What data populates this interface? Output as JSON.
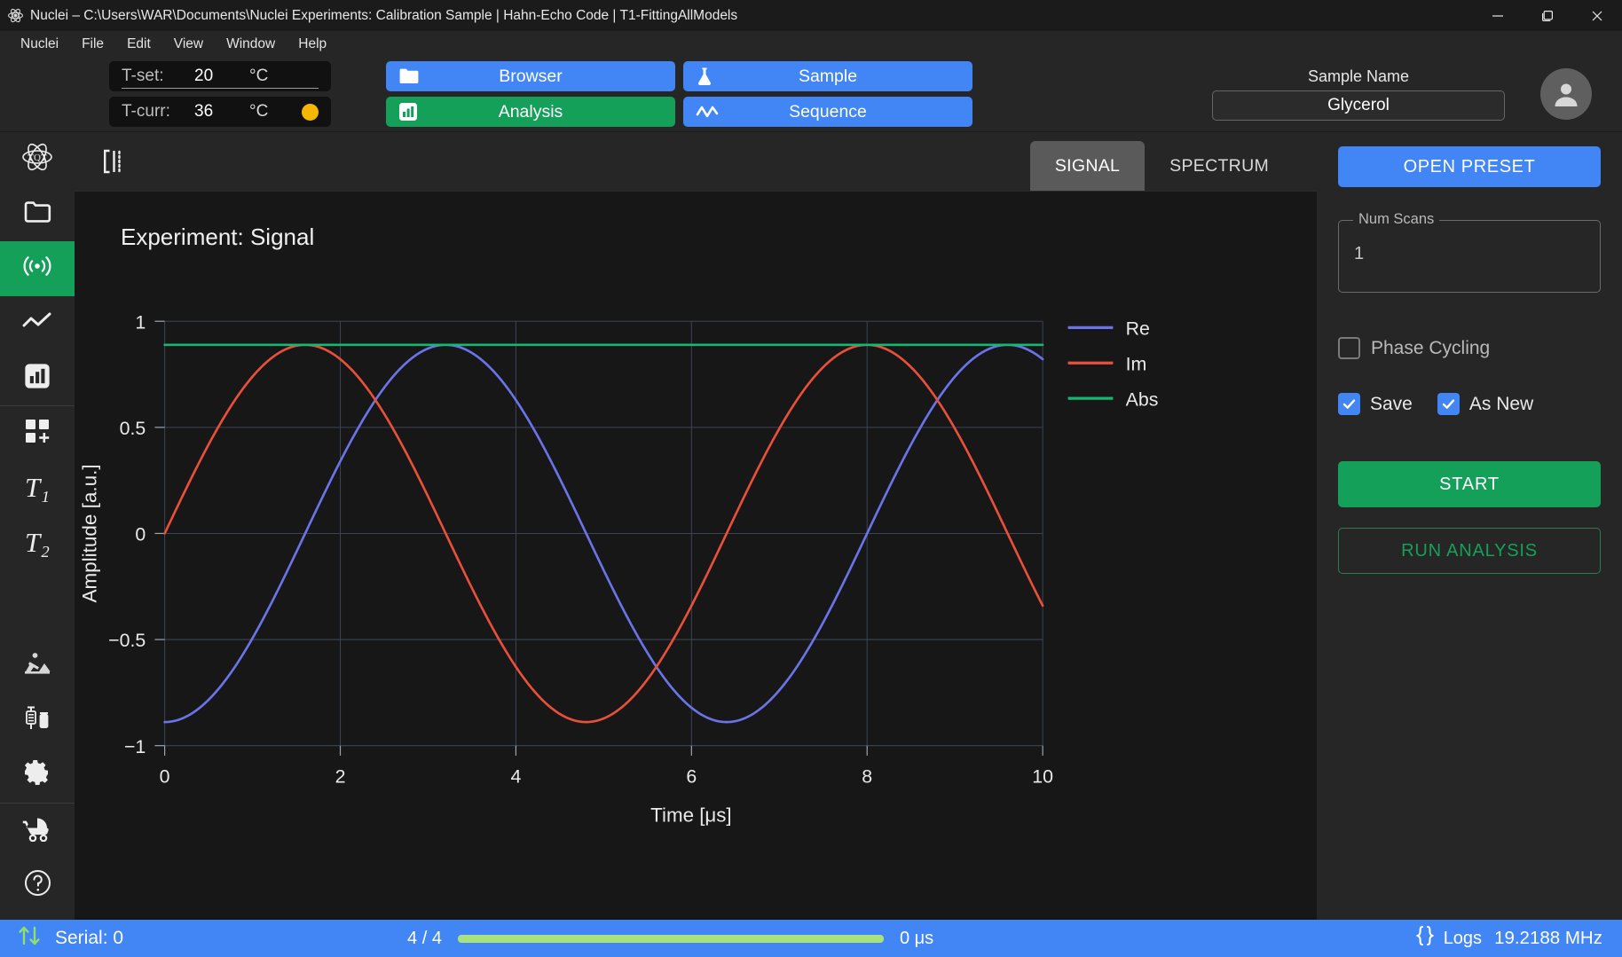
{
  "window": {
    "title": "Nuclei – C:\\Users\\WAR\\Documents\\Nuclei Experiments: Calibration Sample | Hahn-Echo Code | T1-FittingAllModels",
    "app_icon": "atom-icon",
    "minimize": "—",
    "maximize": "❐",
    "close": "✕"
  },
  "menubar": {
    "items": [
      {
        "label": "Nuclei"
      },
      {
        "label": "File"
      },
      {
        "label": "Edit"
      },
      {
        "label": "View"
      },
      {
        "label": "Window"
      },
      {
        "label": "Help"
      }
    ]
  },
  "toolbar": {
    "t_set": {
      "label": "T-set:",
      "value": "20",
      "unit": "°C"
    },
    "t_curr": {
      "label": "T-curr:",
      "value": "36",
      "unit": "°C",
      "status_color": "#f5b800"
    },
    "buttons": [
      {
        "label": "Browser",
        "icon": "folder-icon",
        "color": "#4285f4"
      },
      {
        "label": "Sample",
        "icon": "flask-icon",
        "color": "#4285f4"
      },
      {
        "label": "Analysis",
        "icon": "bar-chart-icon",
        "color": "#15a05a"
      },
      {
        "label": "Sequence",
        "icon": "waveform-icon",
        "color": "#4285f4"
      }
    ],
    "sample": {
      "label": "Sample Name",
      "value": "Glycerol"
    },
    "avatar": "user-avatar-icon"
  },
  "sidebar": {
    "items": [
      {
        "name": "logo",
        "icon": "atom-logo-icon",
        "active": false
      },
      {
        "name": "browser",
        "icon": "folder-icon",
        "active": false
      },
      {
        "name": "signal",
        "icon": "broadcast-icon",
        "active": true
      },
      {
        "name": "trend",
        "icon": "line-chart-icon",
        "active": false
      },
      {
        "name": "analysis",
        "icon": "bar-chart-icon",
        "active": false
      },
      {
        "name": "add-module",
        "icon": "grid-plus-icon",
        "active": false
      },
      {
        "name": "t1",
        "icon": "t1-icon",
        "label": "T₁",
        "active": false
      },
      {
        "name": "t2",
        "icon": "t2-icon",
        "label": "T₂",
        "active": false
      },
      {
        "name": "maintenance",
        "icon": "construction-icon",
        "active": false
      },
      {
        "name": "samples",
        "icon": "syringe-vial-icon",
        "active": false
      },
      {
        "name": "settings",
        "icon": "gear-icon",
        "active": false
      },
      {
        "name": "stroller",
        "icon": "stroller-icon",
        "active": false
      },
      {
        "name": "help",
        "icon": "question-circle-icon",
        "active": false
      }
    ]
  },
  "center": {
    "panel_toggle_icon": "panel-collapse-icon",
    "tabs": [
      {
        "label": "SIGNAL",
        "active": true
      },
      {
        "label": "SPECTRUM",
        "active": false
      }
    ],
    "plot_title": "Experiment:  Signal"
  },
  "chart_data": {
    "type": "line",
    "title": "Experiment:  Signal",
    "xlabel": "Time [μs]",
    "ylabel": "Amplitude [a.u.]",
    "xlim": [
      0,
      10
    ],
    "ylim": [
      -1.08,
      1.08
    ],
    "xticks": [
      0,
      2,
      4,
      6,
      8,
      10
    ],
    "xticklabels": [
      "0",
      "2",
      "4",
      "6",
      "8",
      "10"
    ],
    "yticks": [
      -1,
      -0.5,
      0,
      0.5,
      1
    ],
    "yticklabels": [
      "−1",
      "−0.5",
      "0",
      "0.5",
      "1"
    ],
    "grid": true,
    "legend_position": "outside-right-top",
    "period_us": 6.4,
    "amplitude": 0.96,
    "series": [
      {
        "name": "Re",
        "color": "#6a74e8",
        "form": "-A*cos(2*pi*t/T)",
        "start_value": -0.96
      },
      {
        "name": "Im",
        "color": "#e8503a",
        "form": "A*sin(2*pi*t/T)",
        "start_value": -0.07
      },
      {
        "name": "Abs",
        "color": "#14b870",
        "form": "A (constant)",
        "start_value": 0.96
      }
    ]
  },
  "rightpanel": {
    "open_preset": "OPEN PRESET",
    "num_scans": {
      "label": "Num Scans",
      "value": "1"
    },
    "phase_cycling": {
      "label": "Phase Cycling",
      "checked": false
    },
    "save": {
      "label": "Save",
      "checked": true
    },
    "as_new": {
      "label": "As New",
      "checked": true
    },
    "start": "START",
    "run_analysis": "RUN ANALYSIS"
  },
  "statusbar": {
    "transfer_icon": "up-down-arrows-icon",
    "serial": "Serial: 0",
    "scan_count": "4 / 4",
    "progress_percent": 100,
    "elapsed": "0 μs",
    "logs_icon": "braces-icon",
    "logs": "Logs",
    "frequency": "19.2188 MHz"
  }
}
